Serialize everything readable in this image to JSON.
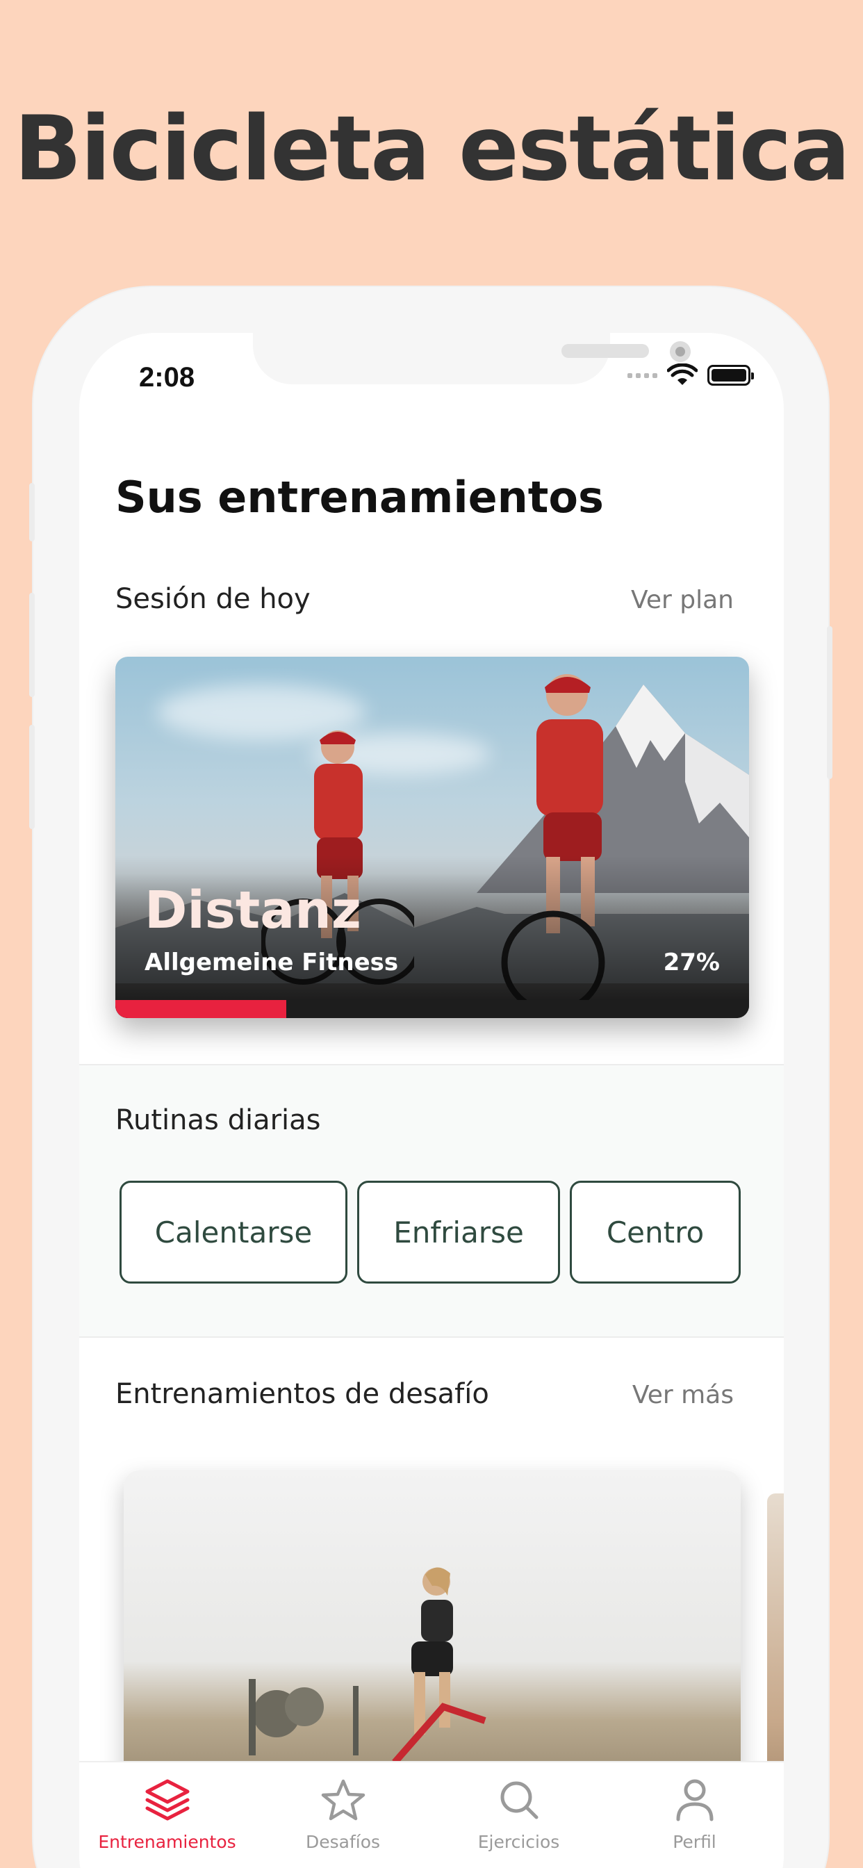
{
  "headline": "Bicicleta estática",
  "status_bar": {
    "time": "2:08"
  },
  "page_title": "Sus entrenamientos",
  "today": {
    "label": "Sesión de hoy",
    "link": "Ver plan",
    "card": {
      "title": "Distanz",
      "subtitle": "Allgemeine Fitness",
      "progress_text": "27%",
      "progress": 0.27
    }
  },
  "routines": {
    "label": "Rutinas diarias",
    "buttons": [
      "Calentarse",
      "Enfriarse",
      "Centro"
    ]
  },
  "challenges": {
    "label": "Entrenamientos de desafío",
    "link": "Ver más"
  },
  "tabs": [
    {
      "label": "Entrenamientos",
      "icon": "layers-icon",
      "active": true
    },
    {
      "label": "Desafíos",
      "icon": "star-icon",
      "active": false
    },
    {
      "label": "Ejercicios",
      "icon": "search-icon",
      "active": false
    },
    {
      "label": "Perfil",
      "icon": "person-icon",
      "active": false
    }
  ],
  "colors": {
    "background": "#fdd5bd",
    "accent": "#e8223f",
    "routine_border": "#2f4a3f"
  }
}
